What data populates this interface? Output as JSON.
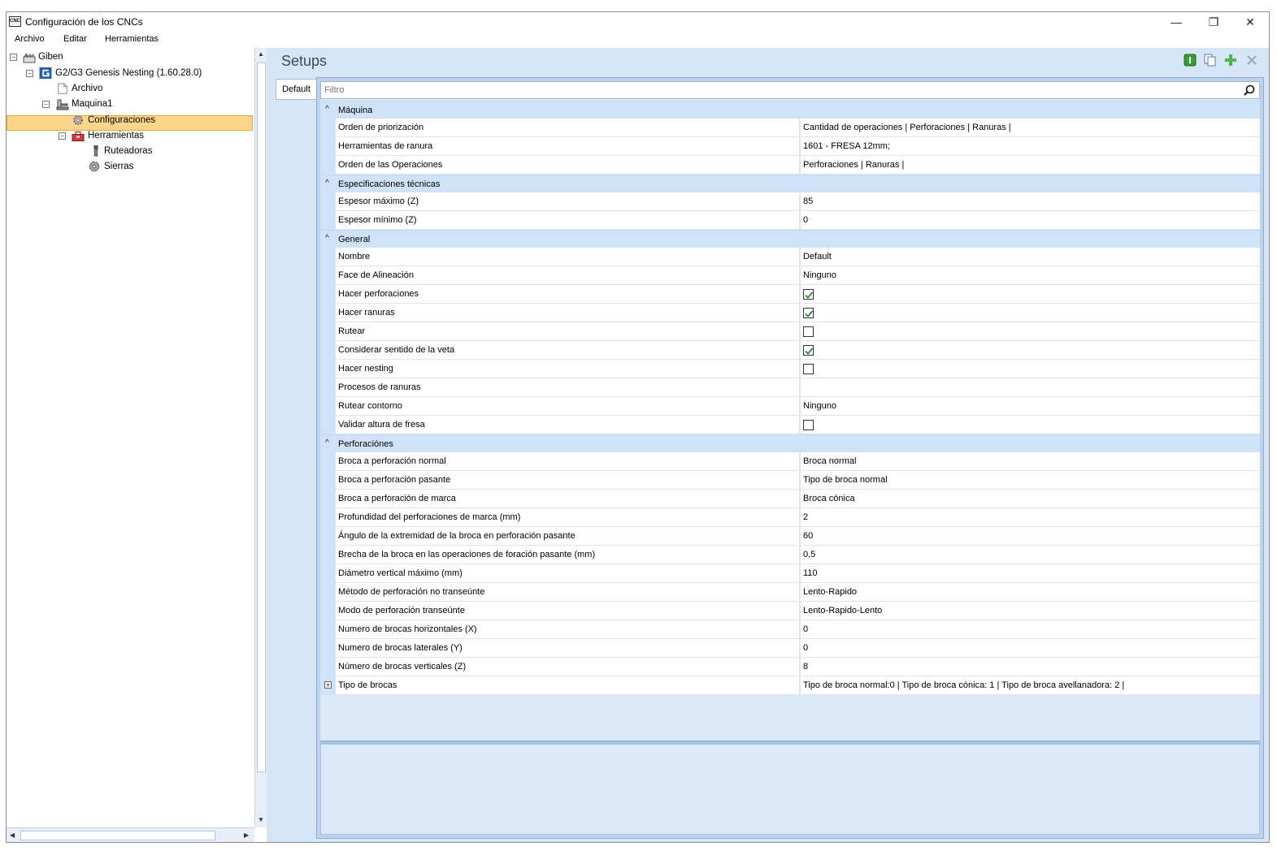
{
  "window": {
    "title": "Configuración de los CNCs",
    "app_icon_text": "CNC",
    "controls": {
      "minimize": "—",
      "restore": "❐",
      "close": "✕"
    }
  },
  "menu": [
    "Archivo",
    "Editar",
    "Herramientas"
  ],
  "tree": {
    "root": "Giben",
    "machine_group": "G2/G3 Genesis Nesting (1.60.28.0)",
    "archivo": "Archivo",
    "machine": "Maquina1",
    "configuraciones": "Configuraciones",
    "herramientas": "Herramientas",
    "ruteadoras": "Ruteadoras",
    "sierras": "Sierras",
    "selected": "Configuraciones"
  },
  "setups": {
    "title": "Setups",
    "tab": "Default",
    "filter_placeholder": "Filtro"
  },
  "categories": {
    "maquina": {
      "label": "Máquina",
      "rows": [
        {
          "name": "Orden de priorización",
          "value": "Cantidad de operaciones | Perforaciones | Ranuras |"
        },
        {
          "name": "Herramientas de ranura",
          "value": "1601 - FRESA 12mm;"
        },
        {
          "name": "Orden de las Operaciones",
          "value": "Perforaciones | Ranuras |"
        }
      ]
    },
    "especificaciones": {
      "label": "Especificaciones técnicas",
      "rows": [
        {
          "name": "Espesor máximo (Z)",
          "value": "85"
        },
        {
          "name": "Espesor mínimo (Z)",
          "value": "0"
        }
      ]
    },
    "general": {
      "label": "General",
      "rows": [
        {
          "name": "Nombre",
          "value": "Default"
        },
        {
          "name": "Face de Alineación",
          "value": "Ninguno"
        },
        {
          "name": "Hacer perforaciones",
          "checked": true
        },
        {
          "name": "Hacer ranuras",
          "checked": true
        },
        {
          "name": "Rutear",
          "checked": false
        },
        {
          "name": "Considerar sentido de la veta",
          "checked": true
        },
        {
          "name": "Hacer nesting",
          "checked": false
        },
        {
          "name": "Procesos de ranuras",
          "value": ""
        },
        {
          "name": "Rutear contorno",
          "value": "Ninguno"
        },
        {
          "name": "Validar altura de fresa",
          "checked": false
        }
      ]
    },
    "perforaciones": {
      "label": "Perforaciónes",
      "rows": [
        {
          "name": "Broca a perforación normal",
          "value": "Broca normal"
        },
        {
          "name": "Broca a perforación pasante",
          "value": "Tipo de broca normal"
        },
        {
          "name": "Broca a perforación de marca",
          "value": "Broca cónica"
        },
        {
          "name": "Profundidad del perforaciones de marca (mm)",
          "value": "2"
        },
        {
          "name": "Ángulo de la extremidad de la broca en perforación pasante",
          "value": "60"
        },
        {
          "name": "Brecha de la broca en las operaciones de foración pasante (mm)",
          "value": "0,5"
        },
        {
          "name": "Diámetro vertical máximo (mm)",
          "value": "110"
        },
        {
          "name": "Método de perforación no transeúnte",
          "value": "Lento-Rapido"
        },
        {
          "name": "Modo de perforación transeúnte",
          "value": "Lento-Rapido-Lento"
        },
        {
          "name": "Numero de brocas horizontales (X)",
          "value": "0"
        },
        {
          "name": "Numero de brocas laterales (Y)",
          "value": "0"
        },
        {
          "name": "Número de brocas verticales (Z)",
          "value": "8"
        }
      ]
    },
    "tipo_brocas": {
      "name": "Tipo de brocas",
      "value": "Tipo de broca normal:0  |  Tipo de broca cónica: 1  |  Tipo de broca avellanadora: 2  |"
    }
  },
  "colors": {
    "selection": "#fbd68a",
    "panel_bg": "#d6e5f7",
    "category_bg": "#d0e2f7",
    "check_green": "#2e8b3a"
  },
  "icons": {
    "toolbar": [
      "green-info-icon",
      "copy-icon",
      "add-icon",
      "delete-icon"
    ],
    "search": "search-icon"
  }
}
